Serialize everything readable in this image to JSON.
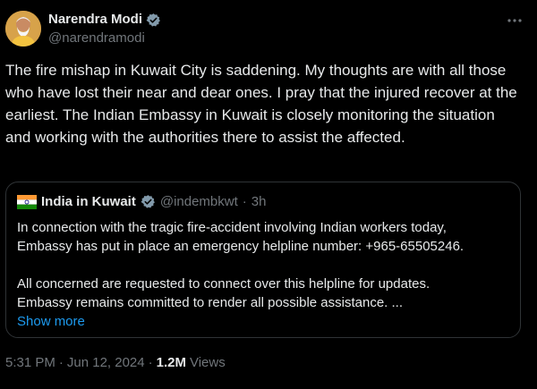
{
  "author": {
    "name": "Narendra Modi",
    "handle": "@narendramodi"
  },
  "tweet": {
    "text": "The fire mishap in Kuwait City is saddening. My thoughts are with all those who have lost their near and dear ones. I pray that the injured recover at the earliest. The Indian Embassy in Kuwait is closely monitoring the situation and working with the authorities there to assist the affected."
  },
  "quote": {
    "name": "India in Kuwait",
    "handle": "@indembkwt",
    "separator": "·",
    "time": "3h",
    "line1": "In connection with the tragic fire-accident involving Indian workers today,",
    "line2": "Embassy has put in place an emergency helpline number: +965-65505246.",
    "line3": "All concerned are requested to connect over this helpline for updates.",
    "line4": "Embassy remains committed to render all possible assistance. ...",
    "show_more": "Show more"
  },
  "meta": {
    "time": "5:31 PM",
    "separator": "·",
    "date": "Jun 12, 2024",
    "views_count": "1.2M",
    "views_label": "Views"
  },
  "colors": {
    "background": "#000000",
    "text": "#e7e9ea",
    "secondary": "#71767b",
    "link": "#1d9bf0",
    "verified": "#829aab",
    "border": "#2f3336"
  },
  "icons": {
    "verified": "verified-badge-icon",
    "more": "more-horizontal-icon",
    "flag": "india-flag-icon"
  }
}
